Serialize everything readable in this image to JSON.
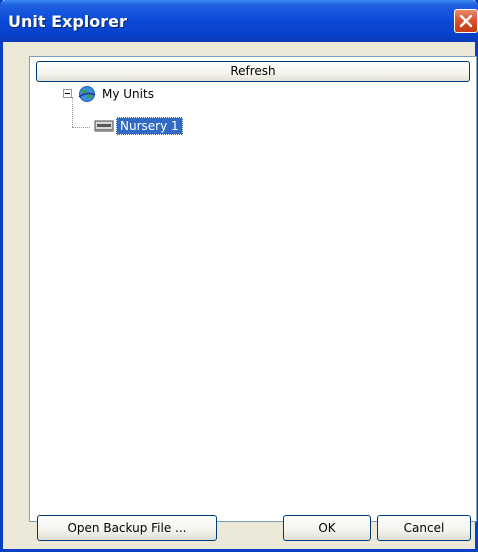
{
  "window": {
    "title": "Unit Explorer",
    "titlebar_color": "#0a4ad8",
    "close_icon": "close-icon"
  },
  "tree": {
    "refresh_label": "Refresh",
    "root": {
      "label": "My Units",
      "icon": "globe-icon",
      "expanded": true,
      "children": [
        {
          "label": "Nursery 1",
          "icon": "unit-device-icon",
          "selected": true
        }
      ]
    },
    "selection_color": "#316ac5"
  },
  "buttons": {
    "open_backup": "Open Backup File ...",
    "ok": "OK",
    "cancel": "Cancel"
  }
}
